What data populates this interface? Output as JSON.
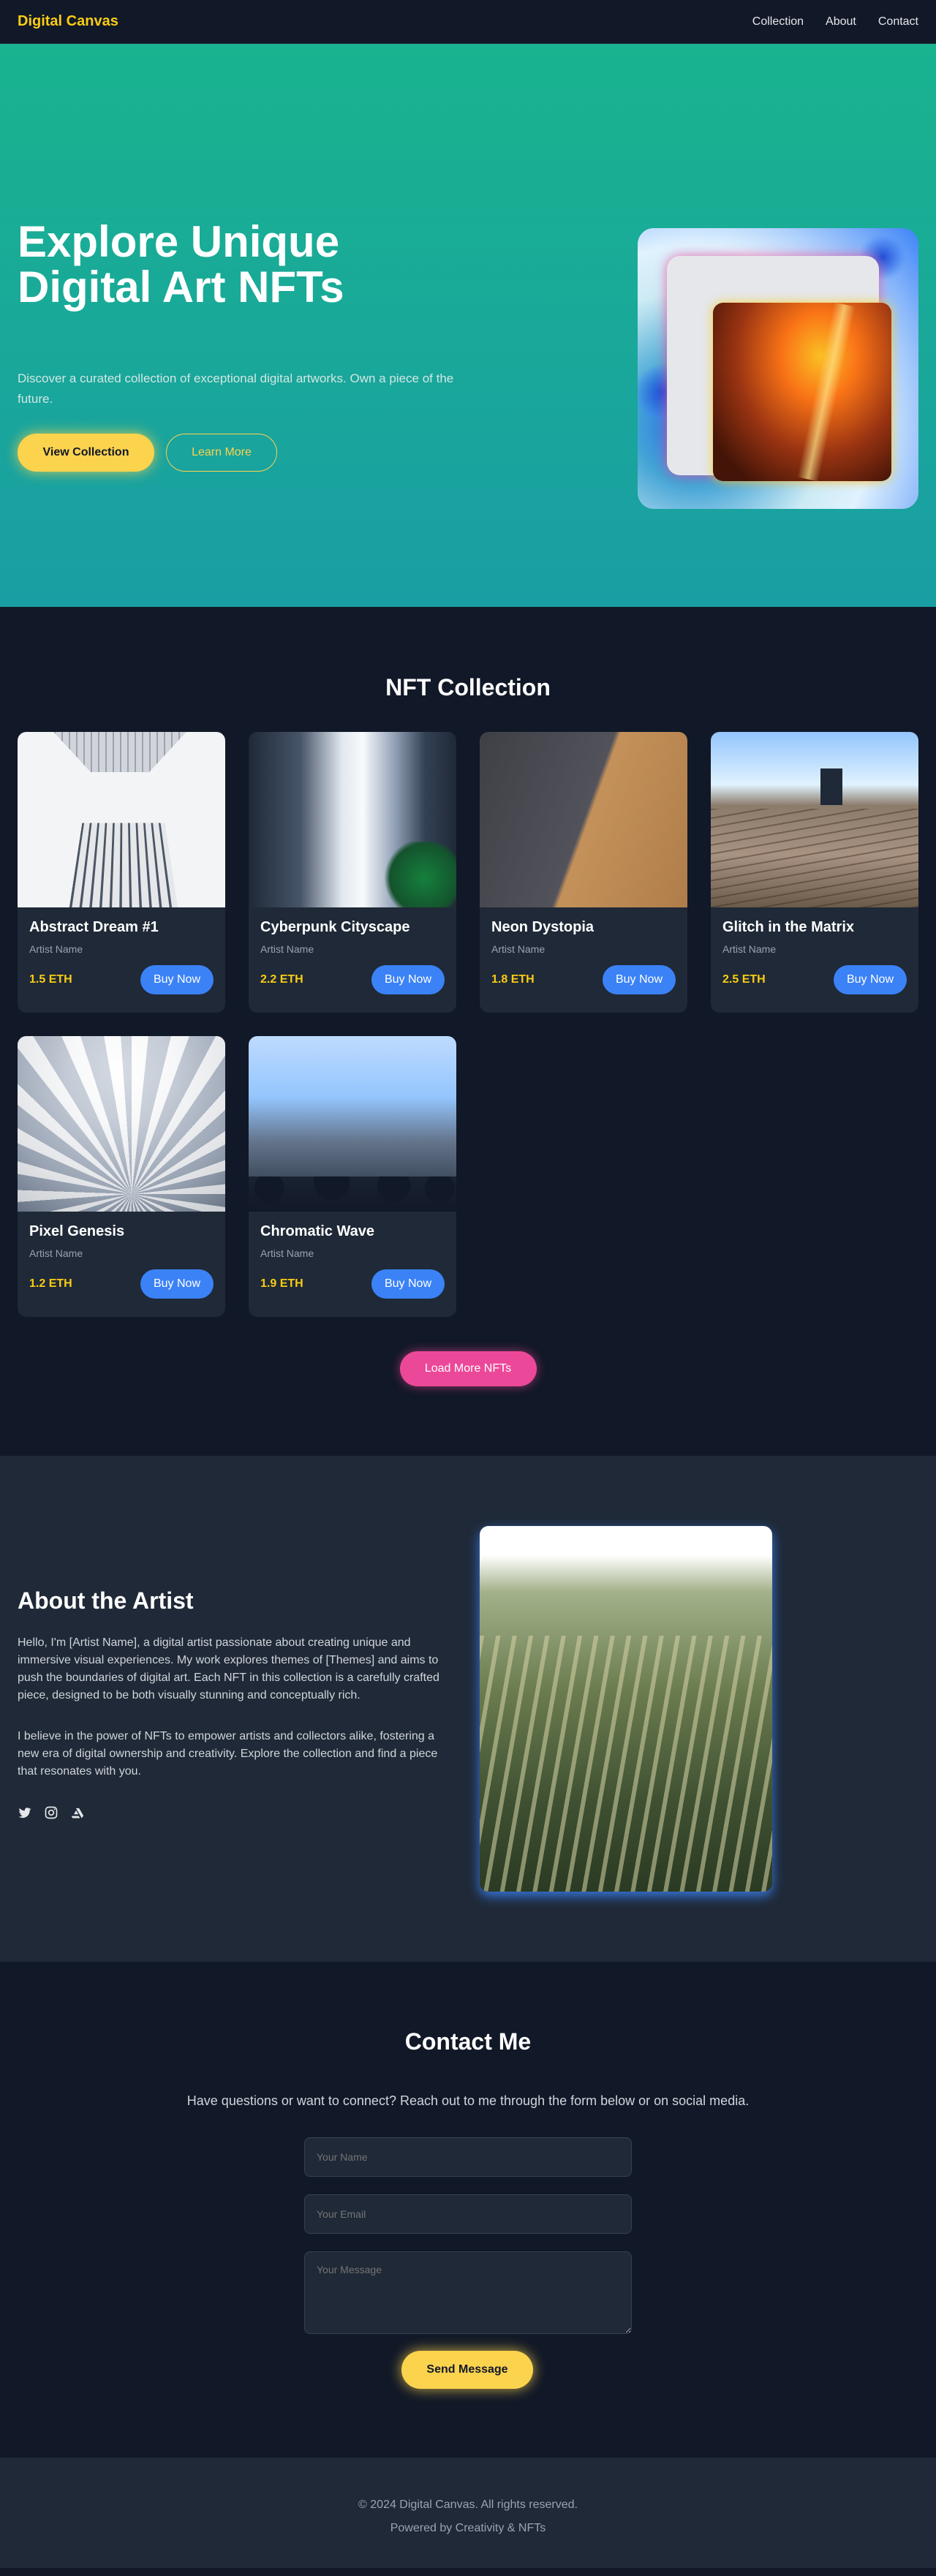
{
  "nav": {
    "brand": "Digital Canvas",
    "links": [
      "Collection",
      "About",
      "Contact"
    ]
  },
  "hero": {
    "title": "Explore Unique Digital Art NFTs",
    "subtitle": "Discover a curated collection of exceptional digital artworks. Own a piece of the future.",
    "primary_label": "View Collection",
    "secondary_label": "Learn More"
  },
  "collection": {
    "title": "NFT Collection",
    "items": [
      {
        "title": "Abstract Dream #1",
        "artist": "Artist Name",
        "price": "1.5 ETH",
        "button": "Buy Now"
      },
      {
        "title": "Cyberpunk Cityscape",
        "artist": "Artist Name",
        "price": "2.2 ETH",
        "button": "Buy Now"
      },
      {
        "title": "Neon Dystopia",
        "artist": "Artist Name",
        "price": "1.8 ETH",
        "button": "Buy Now"
      },
      {
        "title": "Glitch in the Matrix",
        "artist": "Artist Name",
        "price": "2.5 ETH",
        "button": "Buy Now"
      },
      {
        "title": "Pixel Genesis",
        "artist": "Artist Name",
        "price": "1.2 ETH",
        "button": "Buy Now"
      },
      {
        "title": "Chromatic Wave",
        "artist": "Artist Name",
        "price": "1.9 ETH",
        "button": "Buy Now"
      }
    ],
    "load_more": "Load More NFTs"
  },
  "about": {
    "title": "About the Artist",
    "paragraph1": "Hello, I'm [Artist Name], a digital artist passionate about creating unique and immersive visual experiences. My work explores themes of [Themes] and aims to push the boundaries of digital art. Each NFT in this collection is a carefully crafted piece, designed to be both visually stunning and conceptually rich.",
    "paragraph2": "I believe in the power of NFTs to empower artists and collectors alike, fostering a new era of digital ownership and creativity. Explore the collection and find a piece that resonates with you.",
    "social_icons": [
      "twitter-icon",
      "instagram-icon",
      "artstation-icon"
    ]
  },
  "contact": {
    "title": "Contact Me",
    "subtitle": "Have questions or want to connect? Reach out to me through the form below or on social media.",
    "name_placeholder": "Your Name",
    "email_placeholder": "Your Email",
    "message_placeholder": "Your Message",
    "send_label": "Send Message"
  },
  "footer": {
    "copyright": "© 2024 Digital Canvas. All rights reserved.",
    "powered": "Powered by Creativity & NFTs"
  },
  "colors": {
    "accent_yellow": "#fcd34d",
    "accent_blue": "#3b82f6",
    "accent_pink": "#ec4899",
    "hero_teal": "#19b38f",
    "background": "#111827"
  }
}
